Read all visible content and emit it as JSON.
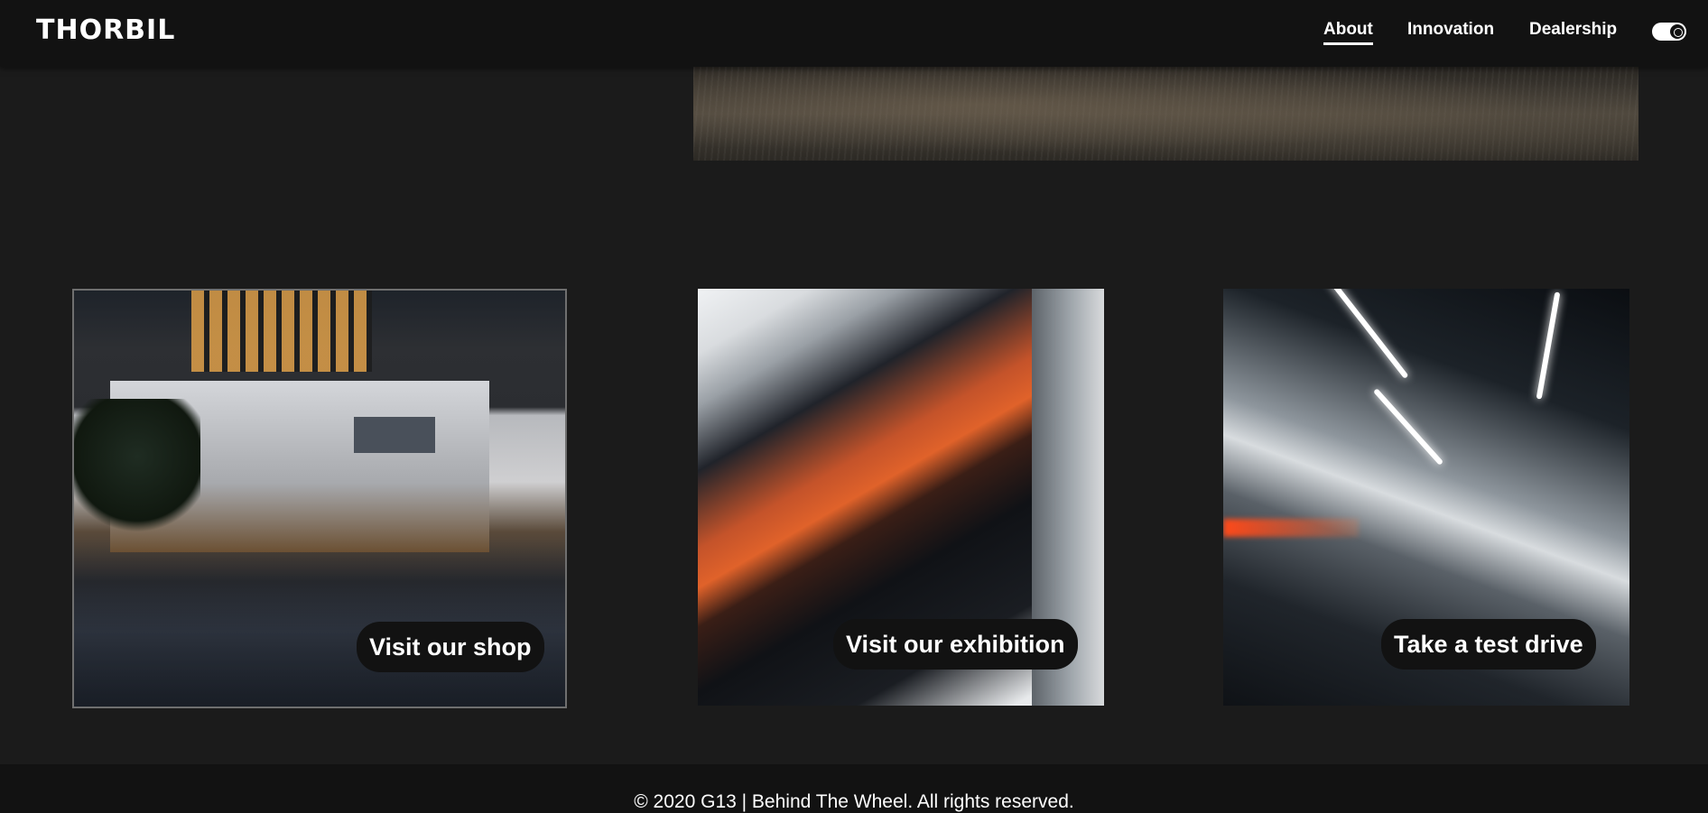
{
  "navbar": {
    "logo": "THORBIL",
    "links": [
      {
        "label": "About",
        "active": true
      },
      {
        "label": "Innovation",
        "active": false
      },
      {
        "label": "Dealership",
        "active": false
      }
    ],
    "theme_toggle_icon": "theme-toggle-icon"
  },
  "cards": [
    {
      "button_label": "Visit our shop",
      "image": "car-shop-street-photo"
    },
    {
      "button_label": "Visit our exhibition",
      "image": "parked-sports-cars-photo"
    },
    {
      "button_label": "Take a test drive",
      "image": "car-in-tunnel-photo"
    }
  ],
  "footer": {
    "text": "© 2020 G13 | Behind The Wheel. All rights reserved."
  },
  "colors": {
    "background": "#1b1b1b",
    "navbar": "#121212",
    "text": "#ffffff",
    "button": "#121212"
  }
}
